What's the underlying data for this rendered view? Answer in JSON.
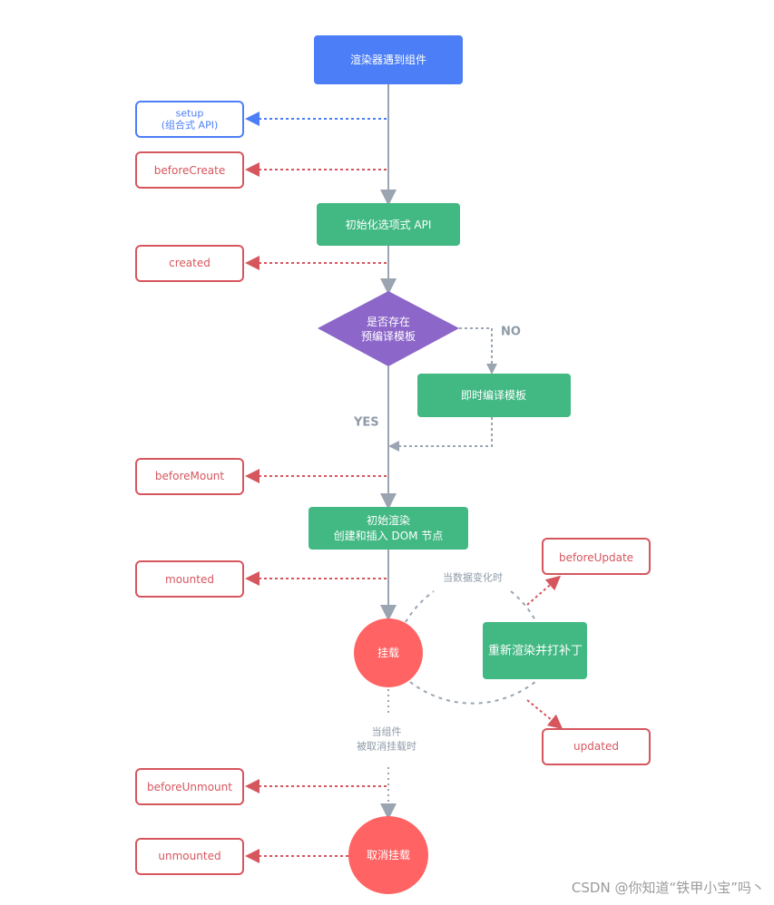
{
  "colors": {
    "blue": "#4b7ef7",
    "green": "#42b883",
    "purple": "#8c66c9",
    "red_fill": "#ff6363",
    "red_stroke": "#d6565e",
    "grey_line": "#9aa5b1"
  },
  "nodes": {
    "renderer_encounters_component": "渲染器遇到组件",
    "init_options_api": "初始化选项式 API",
    "has_precompiled_template_line1": "是否存在",
    "has_precompiled_template_line2": "预编译模板",
    "compile_template_jit": "即时编译模板",
    "initial_render_line1": "初始渲染",
    "initial_render_line2": "创建和插入 DOM 节点",
    "mounted_state": "挂载",
    "rerender_and_patch": "重新渲染并打补丁",
    "unmount_state": "取消挂载"
  },
  "hooks": {
    "setup_line1": "setup",
    "setup_line2": "(组合式 API)",
    "beforeCreate": "beforeCreate",
    "created": "created",
    "beforeMount": "beforeMount",
    "mounted": "mounted",
    "beforeUpdate": "beforeUpdate",
    "updated": "updated",
    "beforeUnmount": "beforeUnmount",
    "unmounted": "unmounted"
  },
  "labels": {
    "no": "NO",
    "yes": "YES",
    "when_data_changes": "当数据变化时",
    "when_unmounted_line1": "当组件",
    "when_unmounted_line2": "被取消挂载时"
  },
  "watermark": "CSDN @你知道“铁甲小宝”吗丶"
}
